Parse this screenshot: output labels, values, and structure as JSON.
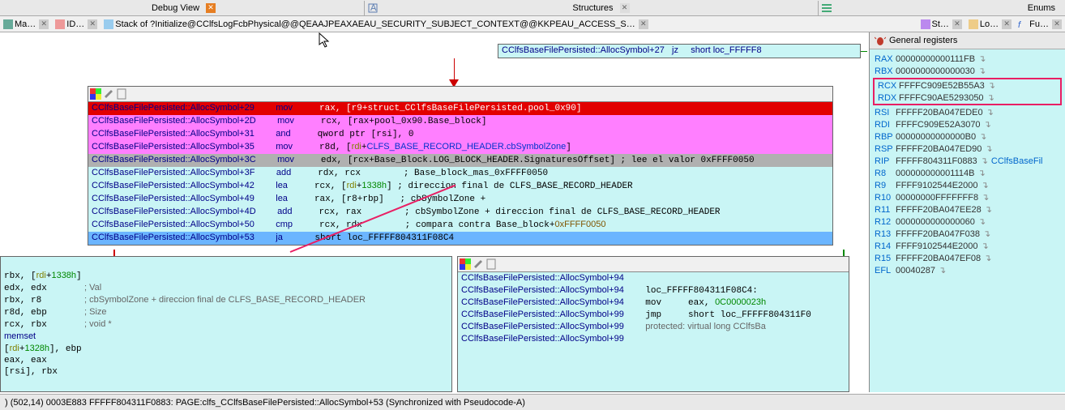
{
  "top_tabs": {
    "debug": "Debug View",
    "structures": "Structures",
    "enums": "Enums"
  },
  "sub_tabs": {
    "ma": "Ma…",
    "id": "ID…",
    "stack": "Stack of ?Initialize@CClfsLogFcbPhysical@@QEAAJPEAXAEAU_SECURITY_SUBJECT_CONTEXT@@KKPEAU_ACCESS_S…",
    "st": "St…",
    "lo": "Lo…",
    "fu": "Fu…"
  },
  "registers": {
    "title": "General registers",
    "rows": [
      {
        "n": "RAX",
        "v": "00000000000111FB"
      },
      {
        "n": "RBX",
        "v": "0000000000000030"
      },
      {
        "n": "RCX",
        "v": "FFFFC909E52B55A3",
        "hl": true
      },
      {
        "n": "RDX",
        "v": "FFFFC90AE5293050",
        "hl": true
      },
      {
        "n": "RSI",
        "v": "FFFFF20BA047EDE0"
      },
      {
        "n": "RDI",
        "v": "FFFFC909E52A3070"
      },
      {
        "n": "RBP",
        "v": "00000000000000B0"
      },
      {
        "n": "RSP",
        "v": "FFFFF20BA047ED90"
      },
      {
        "n": "RIP",
        "v": "FFFFF804311F0883",
        "extra": "CClfsBaseFil"
      },
      {
        "n": "R8",
        "v": "000000000001114B"
      },
      {
        "n": "R9",
        "v": "FFFF9102544E2000"
      },
      {
        "n": "R10",
        "v": "00000000FFFFFFF8"
      },
      {
        "n": "R11",
        "v": "FFFFF20BA047EE28"
      },
      {
        "n": "R12",
        "v": "0000000000000060"
      },
      {
        "n": "R13",
        "v": "FFFFF20BA047F038"
      },
      {
        "n": "R14",
        "v": "FFFF9102544E2000"
      },
      {
        "n": "R15",
        "v": "FFFFF20BA047EF08"
      },
      {
        "n": "EFL",
        "v": "00040287"
      }
    ]
  },
  "top_snippet": "CClfsBaseFilePersisted::AllocSymbol+27   jz     short loc_FFFFF8",
  "main_block": {
    "lines": [
      {
        "bg": "red",
        "addr": "CClfsBaseFilePersisted::AllocSymbol+29",
        "op": "mov",
        "args": "rax, [r9+struct_CClfsBaseFilePersisted.pool_0x90]"
      },
      {
        "bg": "magenta",
        "addr": "CClfsBaseFilePersisted::AllocSymbol+2D",
        "op": "mov",
        "args": "rcx, [rax+pool_0x90.Base_block]"
      },
      {
        "bg": "magenta",
        "addr": "CClfsBaseFilePersisted::AllocSymbol+31",
        "op": "and",
        "args": "qword ptr [rsi], 0"
      },
      {
        "bg": "magenta",
        "addr": "CClfsBaseFilePersisted::AllocSymbol+35",
        "op": "mov",
        "args_html": "r8d, [<span class='c-olive'>rdi</span>+<span class='c-blue'>CLFS_BASE_RECORD_HEADER.cbSymbolZone</span>]"
      },
      {
        "bg": "gray",
        "addr": "CClfsBaseFilePersisted::AllocSymbol+3C",
        "op": "mov",
        "args": "edx, [rcx+Base_Block.LOG_BLOCK_HEADER.SignaturesOffset] ; lee el valor 0xFFFF0050"
      },
      {
        "bg": "cyan",
        "addr": "CClfsBaseFilePersisted::AllocSymbol+3F",
        "op": "add",
        "args": "rdx, rcx        ; Base_block_mas_0xFFFF0050"
      },
      {
        "bg": "cyan",
        "addr": "CClfsBaseFilePersisted::AllocSymbol+42",
        "op": "lea",
        "args_html": "rcx, [<span class='c-olive'>rdi</span>+<span class='c-green'>1338h</span>] ; direccion final de CLFS_BASE_RECORD_HEADER"
      },
      {
        "bg": "cyan",
        "addr": "CClfsBaseFilePersisted::AllocSymbol+49",
        "op": "lea",
        "args": "rax, [r8+rbp]   ; cbSymbolZone +"
      },
      {
        "bg": "cyan",
        "addr": "CClfsBaseFilePersisted::AllocSymbol+4D",
        "op": "add",
        "args": "rcx, rax        ; cbSymbolZone + direccion final de CLFS_BASE_RECORD_HEADER"
      },
      {
        "bg": "cyan",
        "addr": "CClfsBaseFilePersisted::AllocSymbol+50",
        "op": "cmp",
        "args_html": "rcx, rdx        ; compara contra Base_block+<span class='c-brown'>0xFFFF0050</span>"
      },
      {
        "bg": "bluesel",
        "addr": "CClfsBaseFilePersisted::AllocSymbol+53",
        "op": "ja",
        "args": "short loc_FFFFF804311F08C4"
      }
    ]
  },
  "left_bottom": [
    "rbx, [<span class='c-olive'>rdi</span>+<span class='c-green'>1338h</span>]",
    "edx, edx       <span class='c-gray'>; Val</span>",
    "rbx, r8        <span class='c-gray'>; cbSymbolZone + direccion final de CLFS_BASE_RECORD_HEADER</span>",
    "r8d, ebp       <span class='c-gray'>; Size</span>",
    "rcx, rbx       <span class='c-gray'>; void *</span>",
    "<span class='c-dblue'>memset</span>",
    "[<span class='c-olive'>rdi</span>+<span class='c-green'>1328h</span>], ebp",
    "eax, eax",
    "[rsi], rbx"
  ],
  "right_bottom": [
    "CClfsBaseFilePersisted::AllocSymbol+94",
    {
      "l": "CClfsBaseFilePersisted::AllocSymbol+94",
      "r": "loc_FFFFF804311F08C4:"
    },
    {
      "l": "CClfsBaseFilePersisted::AllocSymbol+94",
      "r": "mov     eax, <span class='c-green'>0C0000023h</span>"
    },
    {
      "l": "CClfsBaseFilePersisted::AllocSymbol+99",
      "r": "jmp     short loc_FFFFF804311F0"
    },
    {
      "l": "CClfsBaseFilePersisted::AllocSymbol+99",
      "r": "<span class='c-gray'>protected: virtual long CClfsBa</span>"
    },
    "CClfsBaseFilePersisted::AllocSymbol+99"
  ],
  "status": ") (502,14) 0003E883 FFFFF804311F0883: PAGE:clfs_CClfsBaseFilePersisted::AllocSymbol+53 (Synchronized with Pseudocode-A)",
  "chart_data": null
}
